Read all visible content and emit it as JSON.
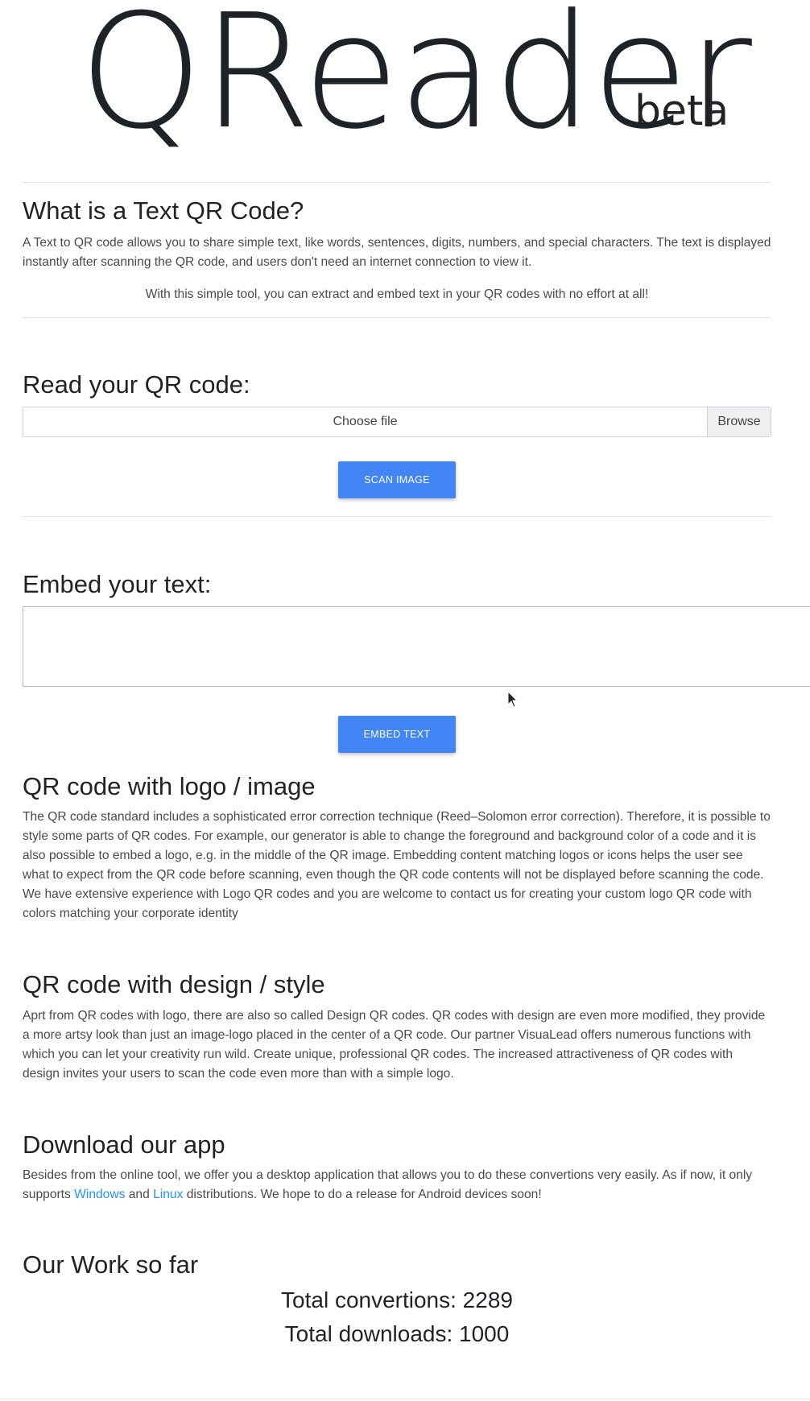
{
  "brand": {
    "name": "QReader",
    "sub": "beta"
  },
  "intro": {
    "title": "What is a Text QR Code?",
    "paragraph": "A Text to QR code allows you to share simple text, like words, sentences, digits, numbers, and special characters. The text is displayed instantly after scanning the QR code, and users don't need an internet connection to view it.",
    "tagline": "With this simple tool, you can extract and embed text in your QR codes with no effort at all!"
  },
  "read": {
    "title": "Read your QR code:",
    "file_label": "Choose file",
    "browse_label": "Browse",
    "scan_button": "SCAN IMAGE"
  },
  "embed": {
    "title": "Embed your text:",
    "textarea_value": "",
    "embed_button": "EMBED TEXT"
  },
  "logo_section": {
    "title": "QR code with logo / image",
    "paragraph": "The QR code standard includes a sophisticated error correction technique (Reed–Solomon error correction). Therefore, it is possible to style some parts of QR codes. For example, our generator is able to change the foreground and background color of a code and it is also possible to embed a logo, e.g. in the middle of the QR image. Embedding content matching logos or icons helps the user see what to expect from the QR code before scanning, even though the QR code contents will not be displayed before scanning the code. We have extensive experience with Logo QR codes and you are welcome to contact us for creating your custom logo QR code with colors matching your corporate identity"
  },
  "design_section": {
    "title": "QR code with design / style",
    "paragraph": "Aprt from QR codes with logo, there are also so called Design QR codes. QR codes with design are even more modified, they provide a more artsy look than just an image-logo placed in the center of a QR code. Our partner VisuaLead offers numerous functions with which you can let your creativity run wild. Create unique, professional QR codes. The increased attractiveness of QR codes with design invites your users to scan the code even more than with a simple logo."
  },
  "download": {
    "title": "Download our app",
    "text_before": "Besides from the online tool, we offer you a desktop application that allows you to do these convertions very easily. As if now, it only supports ",
    "windows_link": "Windows",
    "and_text": " and ",
    "linux_link": "Linux",
    "text_after": " distributions. We hope to do a release for Android devices soon!"
  },
  "stats": {
    "title": "Our Work so far",
    "conversions": "Total convertions: 2289",
    "downloads": "Total downloads: 1000"
  },
  "colors": {
    "primary_button": "#4285f4",
    "link": "#2196f3"
  }
}
